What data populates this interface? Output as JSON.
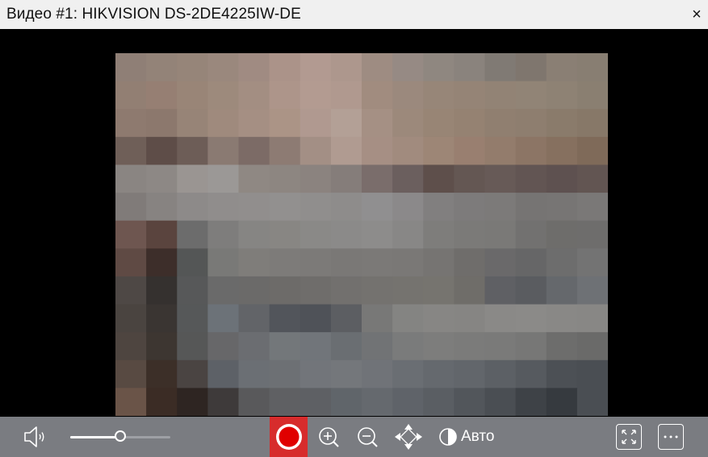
{
  "window": {
    "title": "Видео #1: HIKVISION DS-2DE4225IW-DE",
    "close_label": "×"
  },
  "video": {
    "colors": {
      "background": "#000000",
      "toolbar": "#7a7c81",
      "record_active": "#d72c2c",
      "record_dot": "#e00000"
    },
    "pixelated_preview": [
      [
        "#8f7f76",
        "#938378",
        "#968579",
        "#9a887d",
        "#a08b82",
        "#ab9389",
        "#b29a91",
        "#ad978d",
        "#9e8c82",
        "#968a84",
        "#8f8780",
        "#8a837d",
        "#807a74",
        "#7f766e",
        "#8a7f74",
        "#887e72"
      ],
      [
        "#927f73",
        "#967f73",
        "#998577",
        "#9d8a7c",
        "#a38e82",
        "#ad958a",
        "#b39b91",
        "#b0998f",
        "#a18c7f",
        "#9b897d",
        "#978678",
        "#958476",
        "#928375",
        "#918476",
        "#8e8274",
        "#8a7f71"
      ],
      [
        "#8e7a6f",
        "#8c786d",
        "#978477",
        "#9f8a7d",
        "#a58f83",
        "#ab9486",
        "#b09990",
        "#b3a096",
        "#a59084",
        "#9c897b",
        "#988575",
        "#958272",
        "#907f70",
        "#8e7e6f",
        "#8a7b6b",
        "#877868"
      ],
      [
        "#6f5f58",
        "#5e4d48",
        "#6d5d57",
        "#8a7a72",
        "#7c6b66",
        "#8d7b73",
        "#a38f85",
        "#b09b91",
        "#a68f84",
        "#a18b7e",
        "#9d8676",
        "#997f70",
        "#937c6c",
        "#8c7565",
        "#86705f",
        "#7f6a59"
      ],
      [
        "#8a8582",
        "#8d8885",
        "#9a9592",
        "#9b9896",
        "#8f8883",
        "#8d8681",
        "#8b837f",
        "#857d7a",
        "#7a6d6b",
        "#6b5f5e",
        "#5e4f4b",
        "#645753",
        "#675a57",
        "#625553",
        "#5e5150",
        "#625552"
      ],
      [
        "#807b79",
        "#878381",
        "#8d8a89",
        "#908d8c",
        "#918e8d",
        "#92908f",
        "#908e8d",
        "#8e8c8b",
        "#908f90",
        "#8b898a",
        "#817f7f",
        "#7d7b7b",
        "#7c7a79",
        "#767473",
        "#777574",
        "#7a7877"
      ],
      [
        "#6e5650",
        "#5a443e",
        "#6c6c6c",
        "#7e7d7c",
        "#868583",
        "#888683",
        "#8a8987",
        "#8b8a89",
        "#8d8c8b",
        "#888786",
        "#7e7d7b",
        "#7b7a78",
        "#7a7977",
        "#727170",
        "#6e6d6b",
        "#6e6d6c"
      ],
      [
        "#5f4a44",
        "#3d2e2a",
        "#545656",
        "#797977",
        "#7f7d7a",
        "#7d7b79",
        "#7c7a78",
        "#7a7876",
        "#7b7977",
        "#7a7876",
        "#767472",
        "#6f6d6b",
        "#6a696a",
        "#666667",
        "#6d6d6d",
        "#737373"
      ],
      [
        "#4e4845",
        "#35312f",
        "#575859",
        "#6a6a6a",
        "#6b6a69",
        "#6d6b69",
        "#6f6d6b",
        "#72706e",
        "#74726f",
        "#75736f",
        "#76746f",
        "#6f6d69",
        "#5f6064",
        "#5a5c60",
        "#65686c",
        "#6e7175"
      ],
      [
        "#4a4440",
        "#3a3532",
        "#565859",
        "#6c7278",
        "#626468",
        "#52555b",
        "#4f5258",
        "#5c5e62",
        "#787877",
        "#848482",
        "#878684",
        "#868583",
        "#8a8987",
        "#8b8a88",
        "#898886",
        "#888785"
      ],
      [
        "#4e4540",
        "#3d3631",
        "#565757",
        "#676769",
        "#6b6d71",
        "#73777a",
        "#71757a",
        "#6a6e72",
        "#717375",
        "#7a7b7b",
        "#7d7d7c",
        "#7b7b7a",
        "#7a7a79",
        "#777776",
        "#6d6d6c",
        "#6a6a69"
      ],
      [
        "#584a42",
        "#3c2f28",
        "#4a4442",
        "#5d6167",
        "#6b6f74",
        "#6d7074",
        "#72757a",
        "#74777b",
        "#707378",
        "#6a6e73",
        "#65696e",
        "#62666b",
        "#5c6065",
        "#565a5f",
        "#4c5055",
        "#4a4e53"
      ],
      [
        "#6a5448",
        "#3b2c25",
        "#2e2522",
        "#3e3a3a",
        "#59595b",
        "#5f6063",
        "#5e6064",
        "#60656a",
        "#65696e",
        "#5f6369",
        "#5a5e63",
        "#52565b",
        "#4a4e53",
        "#3e4247",
        "#363a3f",
        "#4a4e53"
      ]
    ]
  },
  "controls": {
    "volume": {
      "level": 0.5
    },
    "color_mode_label": "Авто"
  }
}
